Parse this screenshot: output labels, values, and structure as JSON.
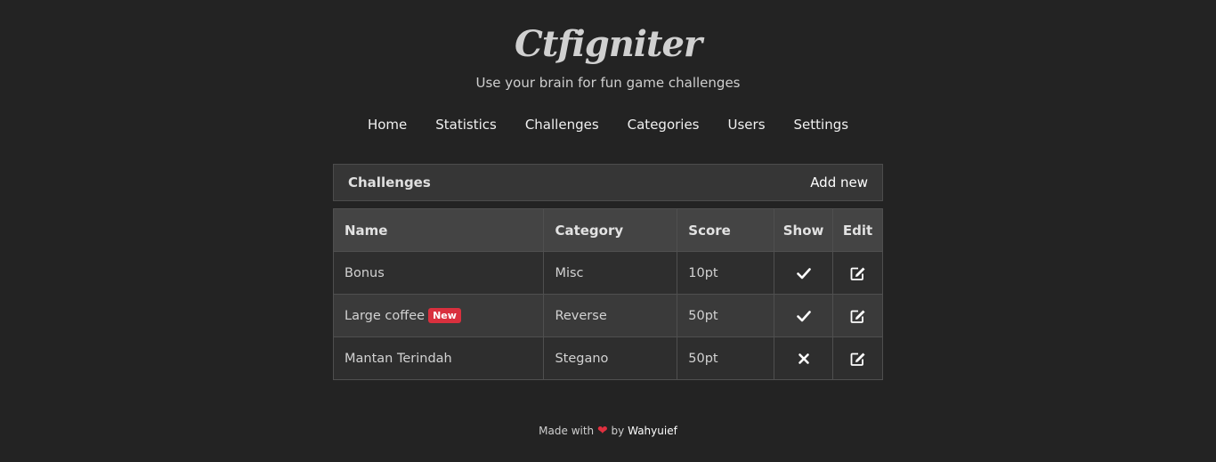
{
  "header": {
    "brand": "Ctfigniter",
    "tagline": "Use your brain for fun game challenges"
  },
  "nav": {
    "items": [
      {
        "label": "Home"
      },
      {
        "label": "Statistics"
      },
      {
        "label": "Challenges"
      },
      {
        "label": "Categories"
      },
      {
        "label": "Users"
      },
      {
        "label": "Settings"
      }
    ]
  },
  "panel": {
    "title": "Challenges",
    "add_label": "Add new"
  },
  "table": {
    "columns": [
      "Name",
      "Category",
      "Score",
      "Show",
      "Edit"
    ],
    "rows": [
      {
        "name": "Bonus",
        "badge": "",
        "category": "Misc",
        "score": "10pt",
        "show": true,
        "show_icon": "check-icon",
        "edit_icon": "edit-icon"
      },
      {
        "name": "Large coffee",
        "badge": "New",
        "category": "Reverse",
        "score": "50pt",
        "show": true,
        "show_icon": "check-icon",
        "edit_icon": "edit-icon"
      },
      {
        "name": "Mantan Terindah",
        "badge": "",
        "category": "Stegano",
        "score": "50pt",
        "show": false,
        "show_icon": "times-icon",
        "edit_icon": "edit-icon"
      }
    ]
  },
  "footer": {
    "made_with": "Made with",
    "heart_icon": "heart-icon",
    "by": "by",
    "author": "Wahyuief"
  },
  "colors": {
    "background": "#232323",
    "badge": "#d9303e",
    "heart": "#e0303f"
  }
}
